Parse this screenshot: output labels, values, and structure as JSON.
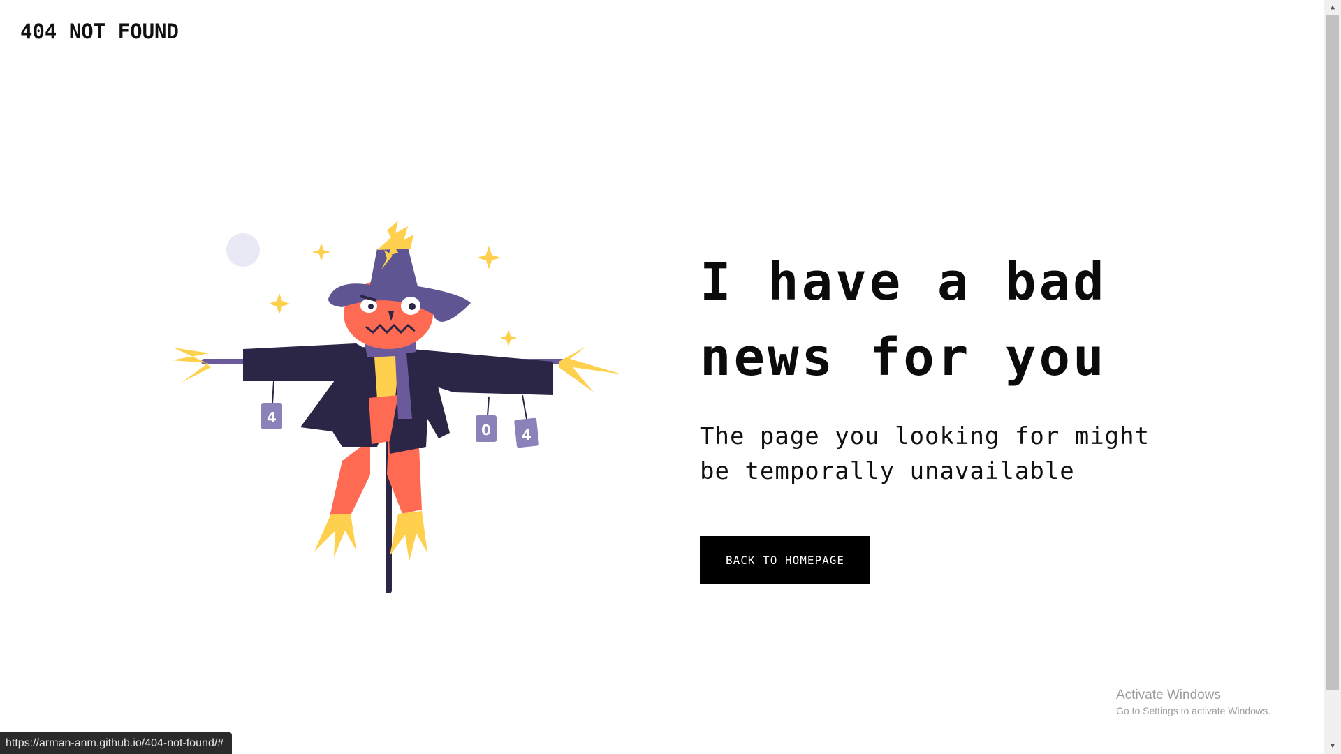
{
  "header": {
    "brand": "404 NOT FOUND"
  },
  "illustration": {
    "can_labels": [
      "4",
      "0",
      "4"
    ],
    "colors": {
      "hat": "#5f5593",
      "coat": "#2b2546",
      "face": "#ff6b52",
      "straw": "#ffd04d",
      "scarf": "#6a5a9c",
      "moon": "#e8e9f5",
      "can": "#8a82b8"
    }
  },
  "main": {
    "headline_line1": "I have a bad",
    "headline_line2": "news for you",
    "subtext_line1": "The page you looking for might",
    "subtext_line2": "be temporally unavailable",
    "button_label": "BACK TO HOMEPAGE"
  },
  "os": {
    "watermark_title": "Activate Windows",
    "watermark_sub": "Go to Settings to activate Windows."
  },
  "statusbar": {
    "url": "https://arman-anm.github.io/404-not-found/#"
  },
  "scrollbar": {
    "up_glyph": "▲",
    "down_glyph": "▼"
  }
}
